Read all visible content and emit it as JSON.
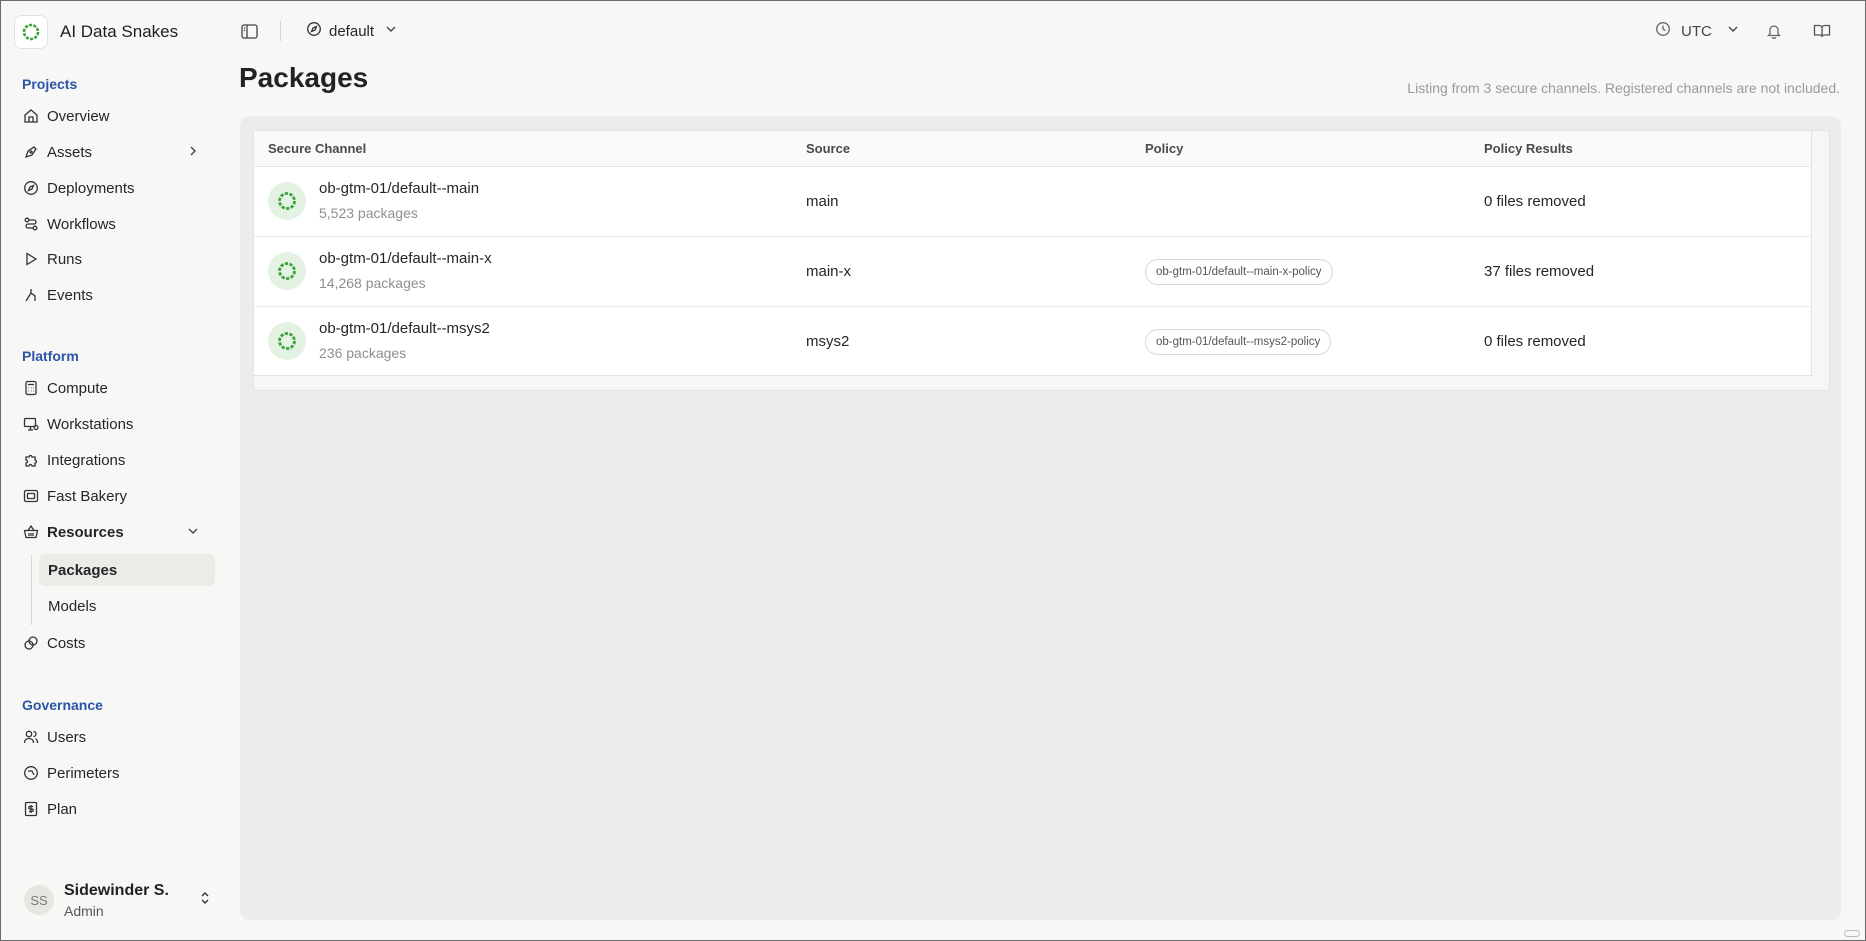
{
  "app": {
    "name": "AI Data Snakes",
    "brand_color": "#3aa13a"
  },
  "topbar": {
    "namespace": "default",
    "timezone": "UTC",
    "icons": [
      "sidebar-toggle-icon",
      "compass-icon",
      "chevron-down-icon",
      "clock-icon",
      "bell-icon",
      "book-icon"
    ]
  },
  "sidebar": {
    "projects_label": "Projects",
    "projects": [
      {
        "label": "Overview",
        "icon": "home-icon"
      },
      {
        "label": "Assets",
        "icon": "pen-icon"
      },
      {
        "label": "Deployments",
        "icon": "compass-icon"
      },
      {
        "label": "Workflows",
        "icon": "workflow-icon"
      },
      {
        "label": "Runs",
        "icon": "play-icon"
      },
      {
        "label": "Events",
        "icon": "merge-icon"
      }
    ],
    "platform_label": "Platform",
    "platform": [
      {
        "label": "Compute",
        "icon": "calculator-icon"
      },
      {
        "label": "Workstations",
        "icon": "monitor-icon"
      },
      {
        "label": "Integrations",
        "icon": "puzzle-icon"
      },
      {
        "label": "Fast Bakery",
        "icon": "image-icon"
      },
      {
        "label": "Resources",
        "icon": "basket-icon"
      }
    ],
    "resources_sub": [
      {
        "label": "Packages"
      },
      {
        "label": "Models"
      }
    ],
    "costs": {
      "label": "Costs",
      "icon": "coins-icon"
    },
    "governance_label": "Governance",
    "governance": [
      {
        "label": "Users",
        "icon": "users-icon"
      },
      {
        "label": "Perimeters",
        "icon": "shield-icon"
      },
      {
        "label": "Plan",
        "icon": "dollar-icon"
      }
    ],
    "user": {
      "initials": "SS",
      "name": "Sidewinder S.",
      "role": "Admin"
    }
  },
  "page": {
    "title": "Packages",
    "note": "Listing from 3 secure channels. Registered channels are not included."
  },
  "table": {
    "columns": [
      "Secure Channel",
      "Source",
      "Policy",
      "Policy Results"
    ],
    "rows": [
      {
        "channel": "ob-gtm-01/default--main",
        "count": "5,523 packages",
        "source": "main",
        "policy": "",
        "result": "0 files removed"
      },
      {
        "channel": "ob-gtm-01/default--main-x",
        "count": "14,268 packages",
        "source": "main-x",
        "policy": "ob-gtm-01/default--main-x-policy",
        "result": "37 files removed"
      },
      {
        "channel": "ob-gtm-01/default--msys2",
        "count": "236 packages",
        "source": "msys2",
        "policy": "ob-gtm-01/default--msys2-policy",
        "result": "0 files removed"
      }
    ]
  }
}
